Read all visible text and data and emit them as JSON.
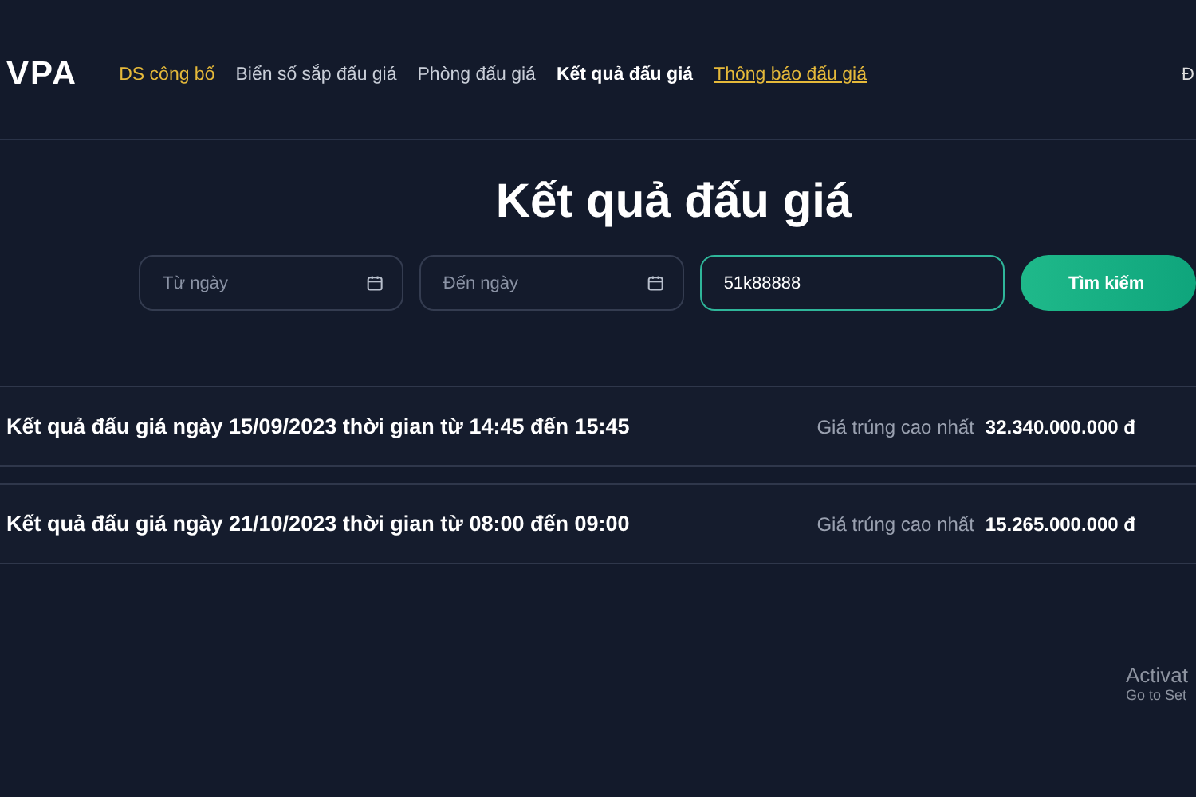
{
  "header": {
    "logo": "VPA",
    "nav": [
      {
        "label": "DS công bố",
        "kind": "gold",
        "selected": false
      },
      {
        "label": "Biển số sắp đấu giá",
        "kind": "plain",
        "selected": false
      },
      {
        "label": "Phòng đấu giá",
        "kind": "plain",
        "selected": false
      },
      {
        "label": "Kết quả đấu giá",
        "kind": "plain",
        "selected": true
      },
      {
        "label": "Thông báo đấu giá",
        "kind": "gold-underline",
        "selected": false
      }
    ],
    "edge_text": "Đ"
  },
  "title": "Kết quả đấu giá",
  "filters": [
    {
      "kind": "date",
      "placeholder": "Từ ngày",
      "focused": false
    },
    {
      "kind": "date",
      "placeholder": "Đến ngày",
      "focused": false
    },
    {
      "kind": "text",
      "value": "51k88888",
      "focused": true
    }
  ],
  "search_button": "Tìm kiếm",
  "results": [
    {
      "title": "Kết quả đấu giá ngày 15/09/2023 thời gian từ 14:45 đến 15:45",
      "price_label": "Giá trúng cao nhất",
      "price": "32.340.000.000 đ"
    },
    {
      "title": "Kết quả đấu giá ngày 21/10/2023 thời gian từ 08:00 đến 09:00",
      "price_label": "Giá trúng cao nhất",
      "price": "15.265.000.000 đ"
    }
  ],
  "activation": {
    "title": "Activat",
    "subtitle": "Go to Set"
  }
}
